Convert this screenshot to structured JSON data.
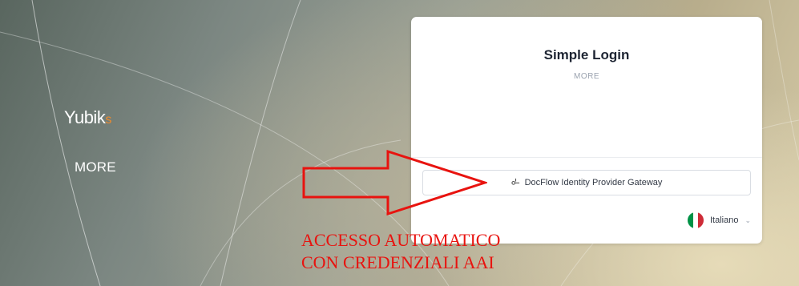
{
  "brand": {
    "logo_text": "Yubik",
    "logo_accent": "s",
    "more_label": "MORE"
  },
  "card": {
    "title": "Simple Login",
    "subtitle": "MORE",
    "provider_button": {
      "label": "DocFlow Identity Provider Gateway",
      "icon": "git-branch-icon"
    },
    "language": {
      "label": "Italiano",
      "flag": "italy-flag-icon"
    }
  },
  "annotation": {
    "line1": "ACCESSO AUTOMATICO",
    "line2": "CON CREDENZIALI AAI",
    "color": "#e8130f"
  },
  "colors": {
    "brand_accent": "#f08a2c",
    "flag_green": "#009246",
    "flag_white": "#ffffff",
    "flag_red": "#ce2b37"
  }
}
